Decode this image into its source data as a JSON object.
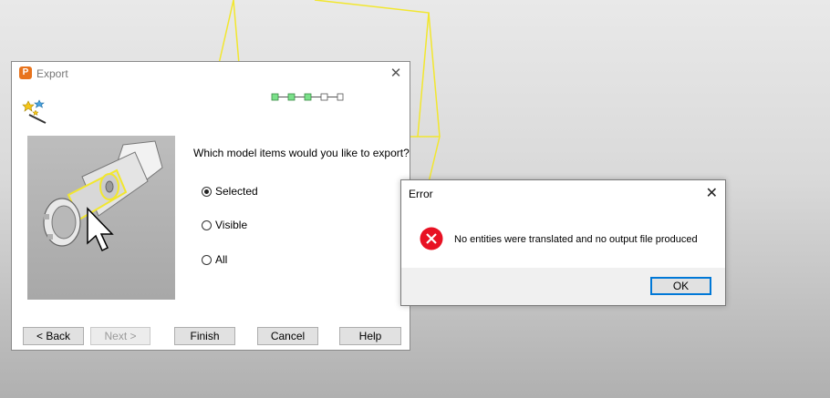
{
  "export_dialog": {
    "title": "Export",
    "app_icon_letter": "P",
    "question": "Which model items would you like to export?",
    "options": [
      {
        "label": "Selected",
        "selected": true
      },
      {
        "label": "Visible",
        "selected": false
      },
      {
        "label": "All",
        "selected": false
      }
    ],
    "progress_steps_done": 3,
    "progress_steps_total": 5,
    "buttons": {
      "back": "< Back",
      "next": "Next >",
      "finish": "Finish",
      "cancel": "Cancel",
      "help": "Help"
    }
  },
  "error_dialog": {
    "title": "Error",
    "message": "No entities were translated and no output file produced",
    "ok": "OK"
  },
  "colors": {
    "accent": "#0078d7",
    "error_red": "#e81123",
    "wireframe_yellow": "#f2e72e",
    "progress_green": "#7be08a"
  }
}
